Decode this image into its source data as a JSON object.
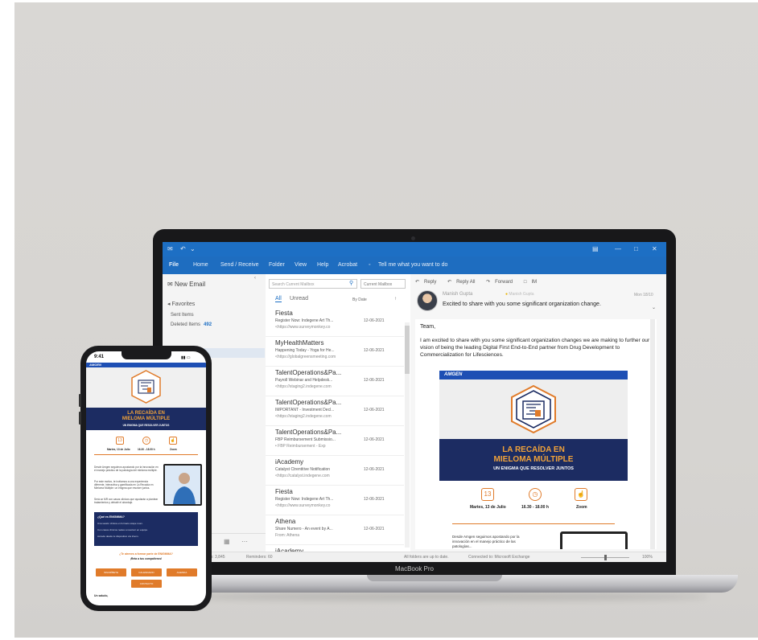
{
  "laptop": {
    "brand": "MacBook Pro",
    "outlook": {
      "ribbon_tabs": [
        "File",
        "Home",
        "Send / Receive",
        "Folder",
        "View",
        "Help",
        "Acrobat"
      ],
      "tell_me": "Tell me what you want to do",
      "nav": {
        "new_email": "New Email",
        "favorites": "Favorites",
        "sent_items": "Sent Items",
        "deleted_items": "Deleted Items",
        "deleted_count": "492"
      },
      "list": {
        "search_placeholder": "Search Current Mailbox",
        "mailbox_scope": "Current Mailbox",
        "filter_all": "All",
        "filter_unread": "Unread",
        "sort": "By Date",
        "messages": [
          {
            "sender": "Fiesta",
            "subject": "Register Now: Indegene Art Th...",
            "preview": "<https://www.surveymonkey.co",
            "date": "12-06-2021"
          },
          {
            "sender": "MyHealthMatters",
            "subject": "Happening Today - Yoga for He...",
            "preview": "<https://globalgreensmeeting.com",
            "date": "12-06-2021"
          },
          {
            "sender": "TalentOperations&Pa...",
            "subject": "Payroll Webinar and Helpdesk...",
            "preview": "<https://staging2.indegene.com",
            "date": "12-06-2021"
          },
          {
            "sender": "TalentOperations&Pa...",
            "subject": "IMPORTANT - Investment Decl...",
            "preview": "<https://staging2.indegene.com",
            "date": "12-06-2021"
          },
          {
            "sender": "TalentOperations&Pa...",
            "subject": "FBP Reimbursement Submissio...",
            "preview": "• FBP Reimbursement - Exp",
            "date": "12-06-2021"
          },
          {
            "sender": "iAcademy",
            "subject": "Catalyst Ctrentitive Notification",
            "preview": "<https://catalyst.indegene.com",
            "date": "12-06-2021"
          },
          {
            "sender": "Fiesta",
            "subject": "Register Now: Indegene Art Th...",
            "preview": "<https://www.surveymonkey.co",
            "date": "12-06-2021"
          },
          {
            "sender": "Athena",
            "subject": "Share Numero - An event by A...",
            "preview": "From: Athena",
            "date": "12-06-2021"
          },
          {
            "sender": "iAcademy",
            "subject": "",
            "preview": "",
            "date": ""
          }
        ]
      },
      "reading": {
        "toolbar": [
          "Reply",
          "Reply All",
          "Forward",
          "IM"
        ],
        "from": "Manish Gupta",
        "flag": "Manish Gupta",
        "date": "Mon 18/10",
        "subject": "Excited to share with you some significant organization change.",
        "greeting": "Team,",
        "body": "I am excited to share with you some significant organization changes we are making to further our vision of being the leading Digital First End-to-End partner from Drug Development to Commercialization for Lifesciences.",
        "newsletter": {
          "logo": "AMGEN",
          "title1": "LA RECAÍDA EN",
          "title2": "MIELOMA MÚLTIPLE",
          "tagline": "UN ENIGMA QUE RESOLVER JUNTOS",
          "date_label": "Martes, 13 de Julio",
          "time_label": "16.30 - 18.00 h",
          "platform_label": "Zoom",
          "calendar_number": "13",
          "intro": "Desde Amgen seguimos apostando por la innovación en el manejo práctico de las patologías..."
        }
      },
      "status": {
        "items": "Items: 3,845",
        "reminders": "Reminders: 60",
        "folders": "All folders are up to date.",
        "connection": "Connected to: Microsoft Exchange",
        "zoom": "100%"
      }
    }
  },
  "phone": {
    "time": "9:41",
    "logo": "AMGEN",
    "title1": "LA RECAÍDA EN",
    "title2": "MIELOMA MÚLTIPLE",
    "tagline": "UN ENIGMA QUE RESOLVER JUNTOS",
    "icon_labels": [
      "Martes, 13 de Julio",
      "16.30 - 18.00 h",
      "Zoom"
    ],
    "calendar_number": "13",
    "intro1": "Desde Amgen seguimos apostando por la innovación en el manejo práctico de la patología del mieloma múltiple.",
    "intro2": "Por este motivo, te invitamos a una experiencia diferente, interactiva y gamificada en La Recaída en Mieloma Múltiple: un enigma que resolver juntos.",
    "intro3": "Será un MR con casos clínicos que ayudarán a plantear tratamientos y debatir el abordaje.",
    "box_title": "¿Qué es ENIGMMA?",
    "box_p1": "Una sesión clínica en formato scape room.",
    "box_p2": "Con casos clínicos reales a resolver en equipo.",
    "box_p3": "Accede desde tu dispositivo vía Zoom.",
    "question1": "¿Te atreves a formar parte de ENIGMMA?",
    "question2": "¡Reta a tus compañeros!",
    "buttons": [
      "INSCRÍBETE",
      "CALENDARIO",
      "AGENDA",
      "CONTACTO"
    ],
    "footer": "Un saludo,"
  },
  "colors": {
    "outlook_blue": "#1d6fc4",
    "amgen_blue": "#1e4fb4",
    "navy": "#1c2c62",
    "orange": "#e07b2a",
    "title_orange": "#f0a23a"
  }
}
